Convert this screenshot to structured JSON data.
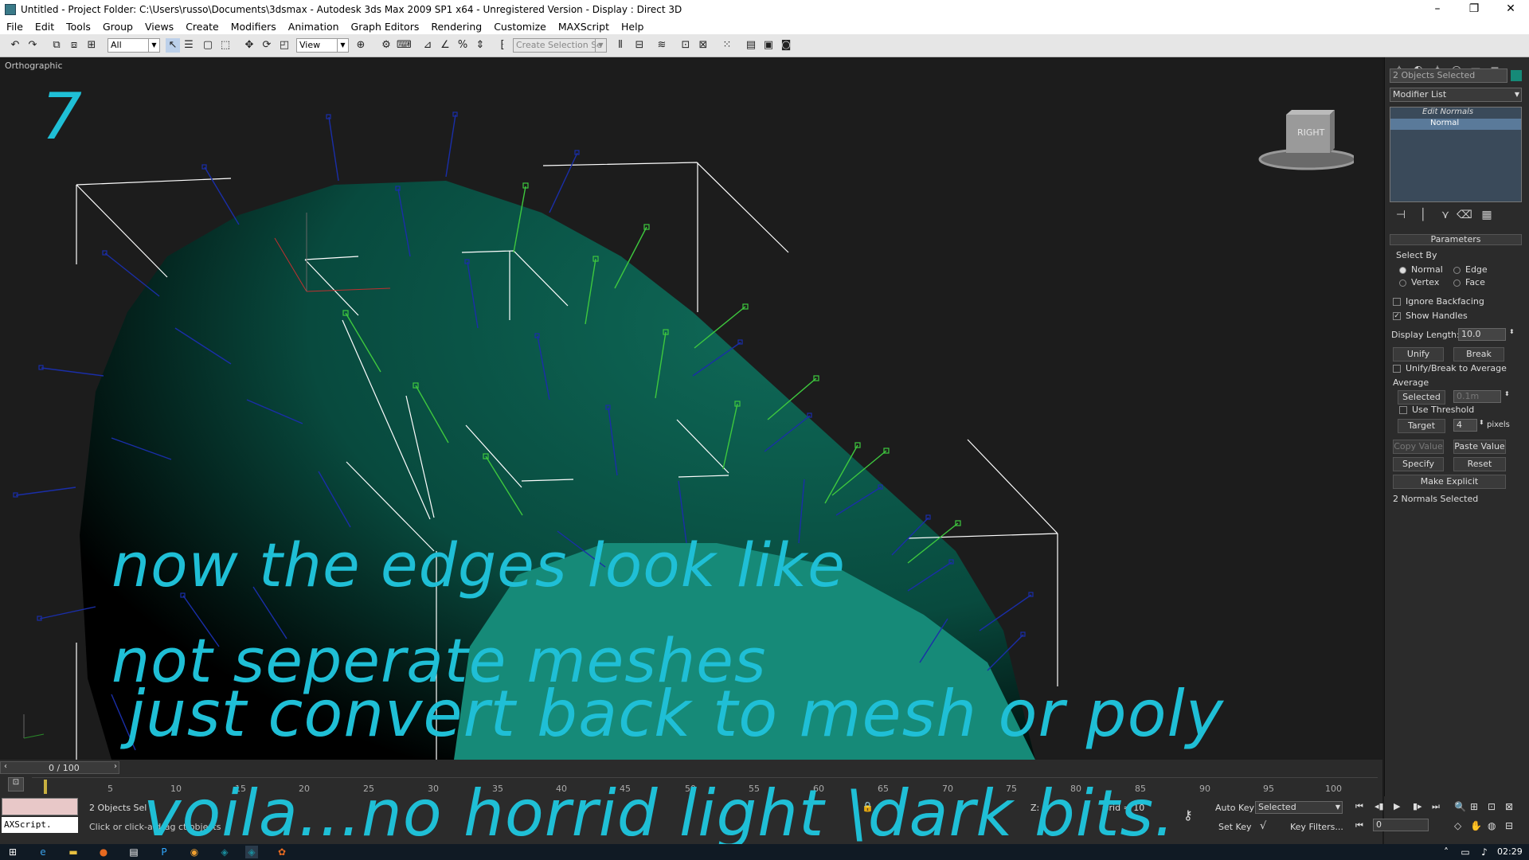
{
  "title": "Untitled      - Project Folder: C:\\Users\\russo\\Documents\\3dsmax   - Autodesk 3ds Max  2009 SP1  x64   - Unregistered Version     - Display : Direct 3D",
  "window_controls": {
    "min": "–",
    "max": "❐",
    "close": "✕"
  },
  "menu": [
    "File",
    "Edit",
    "Tools",
    "Group",
    "Views",
    "Create",
    "Modifiers",
    "Animation",
    "Graph Editors",
    "Rendering",
    "Customize",
    "MAXScript",
    "Help"
  ],
  "toolbar": {
    "filter": "All",
    "refcoord": "View",
    "selset": "Create Selection Se"
  },
  "viewport": {
    "label": "Orthographic",
    "step_number": "7",
    "viewcube": "RIGHT"
  },
  "captions": {
    "line1": "now the edges look like",
    "line2": "not seperate meshes",
    "line3": "just convert back to mesh or poly",
    "line4": "voila...no horrid light \\dark bits."
  },
  "panel": {
    "selection": "2 Objects Selected",
    "modifier_list": "Modifier List",
    "stack": [
      "Edit Normals",
      "Normal"
    ],
    "rollout": "Parameters",
    "select_by": "Select By",
    "radios": {
      "normal": "Normal",
      "edge": "Edge",
      "vertex": "Vertex",
      "face": "Face"
    },
    "ignore_backfacing": "Ignore Backfacing",
    "show_handles": "Show Handles",
    "display_length_label": "Display Length:",
    "display_length": "10.0",
    "unify": "Unify",
    "break": "Break",
    "unify_break_avg": "Unify/Break to Average",
    "average": "Average",
    "selected": "Selected",
    "selected_val": "0.1m",
    "use_threshold": "Use Threshold",
    "target": "Target",
    "target_val": "4",
    "pixels": "pixels",
    "copy_value": "Copy Value",
    "paste_value": "Paste Value",
    "specify": "Specify",
    "reset": "Reset",
    "make_explicit": "Make Explicit",
    "normals_selected": "2 Normals Selected"
  },
  "timeline": {
    "frame": "0 / 100",
    "ticks": [
      "5",
      "10",
      "15",
      "20",
      "25",
      "30",
      "35",
      "40",
      "45",
      "50",
      "55",
      "60",
      "65",
      "70",
      "75",
      "80",
      "85",
      "90",
      "95",
      "100"
    ]
  },
  "status": {
    "maxscript": "AXScript.",
    "objects": "2 Objects Sel",
    "prompt": "Click or click-a  drag     ct objects",
    "z": "Z:",
    "grid": "Grid = 10",
    "auto_key": "Auto Key",
    "set_key": "Set Key",
    "key_mode": "Selected",
    "key_filters": "Key Filters...",
    "frame_field": "0"
  },
  "taskbar": {
    "clock": "02:29"
  },
  "colors": {
    "caption": "#1fbfd6",
    "mesh_dark": "#0a5a4a",
    "mesh_light": "#168a78",
    "normal_blue": "#1a2ea8",
    "normal_green": "#3ec83e"
  }
}
